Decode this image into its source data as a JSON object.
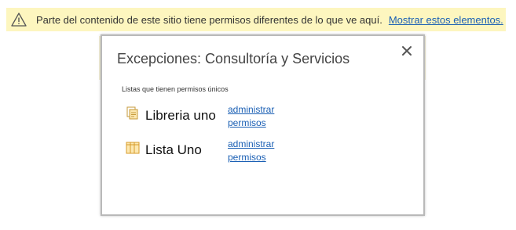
{
  "banner": {
    "message": "Parte del contenido de este sitio tiene permisos diferentes de lo que ve aquí.",
    "link": "Mostrar estos elementos.",
    "icon": "warning-icon"
  },
  "dialog": {
    "title": "Excepciones: Consultoría y Servicios",
    "subheading": "Listas que tienen permisos únicos",
    "items": [
      {
        "name": "Libreria uno",
        "icon": "document-library-icon",
        "action_line1": "administrar",
        "action_line2": "permisos"
      },
      {
        "name": "Lista Uno",
        "icon": "list-icon",
        "action_line1": "administrar",
        "action_line2": "permisos"
      }
    ]
  }
}
